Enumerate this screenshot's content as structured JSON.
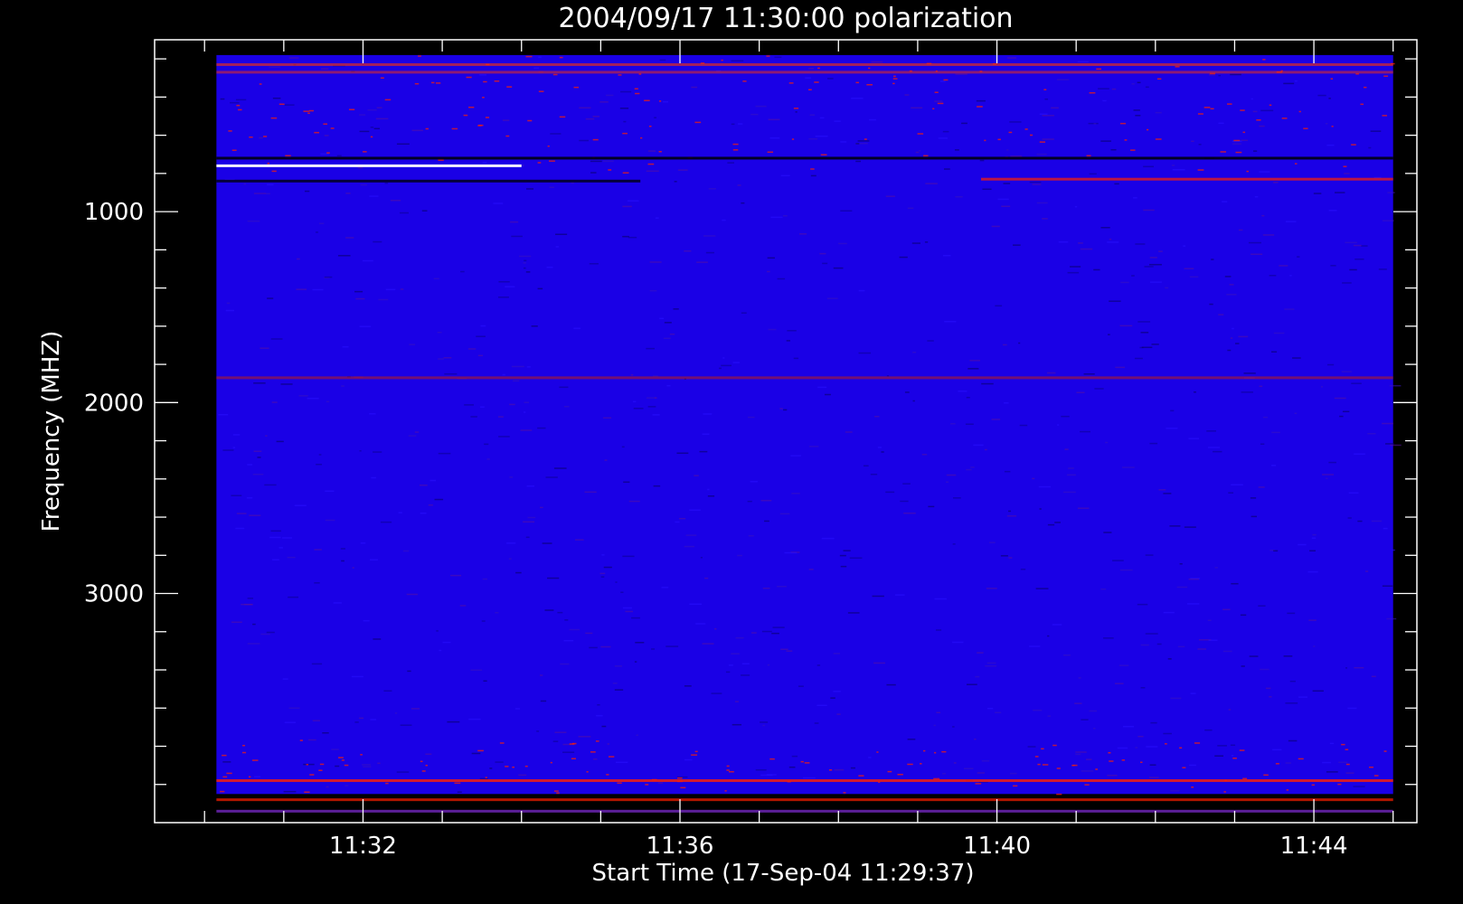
{
  "chart_data": {
    "type": "heatmap",
    "title": "2004/09/17 11:30:00 polarization",
    "xlabel": "Start Time (17-Sep-04 11:29:37)",
    "ylabel": "Frequency (MHZ)",
    "x_tick_labels": [
      "11:32",
      "11:36",
      "11:40",
      "11:44"
    ],
    "y_tick_labels": [
      "1000",
      "2000",
      "3000"
    ],
    "y_major_ticks": [
      1000,
      2000,
      3000
    ],
    "x_major_ticks_minutes": [
      32,
      36,
      40,
      44
    ],
    "xlim_minutes": [
      29.37,
      45.3
    ],
    "ylim": [
      4200,
      100
    ],
    "y_minor_step": 200,
    "x_minor_step_minutes": 1,
    "data_extent": {
      "freq_min": 180,
      "freq_max": 4050,
      "time_start_min": 30.15,
      "time_end_min": 45.0
    },
    "colormap": {
      "background": "#1a00e6",
      "low": "#000033",
      "high": "#ff2000",
      "peak": "#ffffff"
    },
    "features": [
      {
        "kind": "band",
        "freq": 230,
        "color": "#ff3300",
        "t0": 30.15,
        "t1": 45.0,
        "strength": 0.6
      },
      {
        "kind": "band",
        "freq": 270,
        "color": "#ff3300",
        "t0": 30.15,
        "t1": 45.0,
        "strength": 0.5
      },
      {
        "kind": "band",
        "freq": 720,
        "color": "#000010",
        "t0": 30.15,
        "t1": 45.0,
        "strength": 0.9
      },
      {
        "kind": "band",
        "freq": 760,
        "color": "#ffffff",
        "t0": 30.15,
        "t1": 34.0,
        "strength": 0.95
      },
      {
        "kind": "band",
        "freq": 840,
        "color": "#000010",
        "t0": 30.15,
        "t1": 35.5,
        "strength": 0.8
      },
      {
        "kind": "band",
        "freq": 830,
        "color": "#ff2000",
        "t0": 39.8,
        "t1": 45.0,
        "strength": 0.7
      },
      {
        "kind": "band",
        "freq": 1870,
        "color": "#cc2000",
        "t0": 30.15,
        "t1": 45.0,
        "strength": 0.5
      },
      {
        "kind": "band",
        "freq": 3980,
        "color": "#ff2000",
        "t0": 30.15,
        "t1": 45.0,
        "strength": 0.8
      },
      {
        "kind": "band",
        "freq": 4080,
        "color": "#ff2000",
        "t0": 30.15,
        "t1": 45.0,
        "strength": 0.7
      },
      {
        "kind": "band",
        "freq": 4140,
        "color": "#6622aa",
        "t0": 30.15,
        "t1": 45.0,
        "strength": 0.9
      }
    ],
    "grid": false,
    "legend": "none"
  }
}
